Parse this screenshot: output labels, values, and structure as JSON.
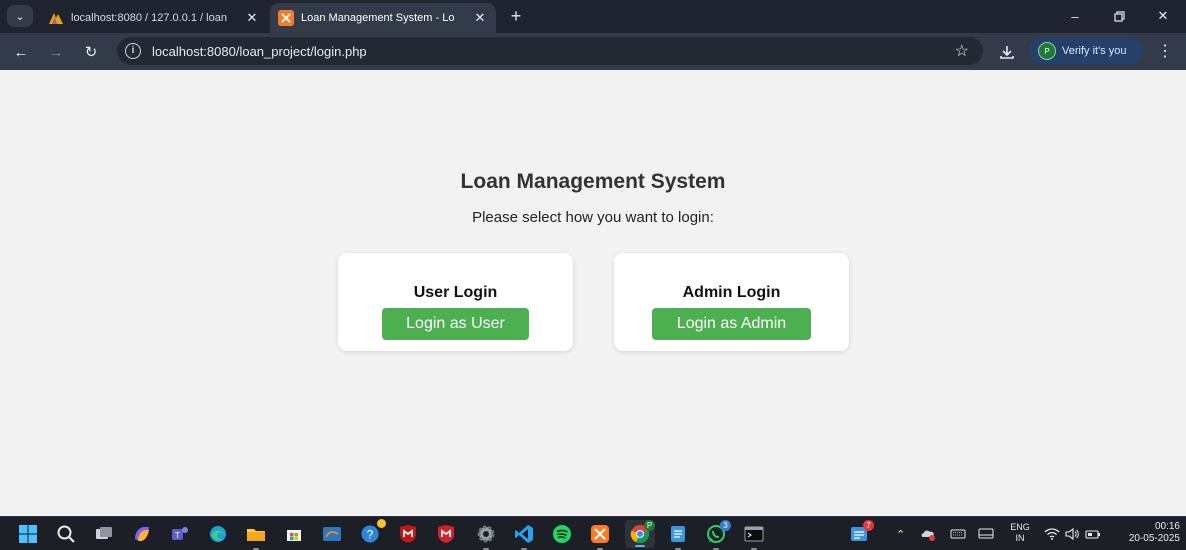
{
  "browser": {
    "tabs": [
      {
        "title": "localhost:8080 / 127.0.0.1 / loan",
        "favicon": "phpmyadmin-icon",
        "active": false
      },
      {
        "title": "Loan Management System - Lo",
        "favicon": "xampp-icon",
        "active": true
      }
    ],
    "url": "localhost:8080/loan_project/login.php",
    "profile_label": "Verify it's you",
    "profile_initial": "P"
  },
  "page": {
    "title": "Loan Management System",
    "subtitle": "Please select how you want to login:",
    "cards": {
      "user": {
        "heading": "User Login",
        "button": "Login as User"
      },
      "admin": {
        "heading": "Admin Login",
        "button": "Login as Admin"
      }
    },
    "accent_color": "#4caf50"
  },
  "taskbar": {
    "teams_badge": "",
    "notes_badge": "7",
    "whatsapp_badge": "3",
    "chrome_profile_badge": "P",
    "language": "ENG",
    "region": "IN",
    "time": "00:16",
    "date": "20-05-2025"
  }
}
